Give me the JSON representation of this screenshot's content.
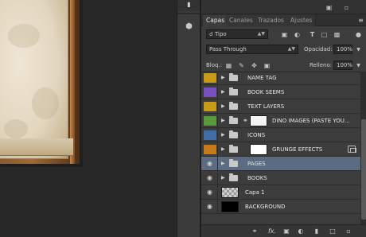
{
  "tabs": [
    {
      "label": "Capas",
      "active": true
    },
    {
      "label": "Canales",
      "active": false
    },
    {
      "label": "Trazados",
      "active": false
    },
    {
      "label": "Ajustes",
      "active": false
    }
  ],
  "filter": {
    "label": "Tipo"
  },
  "blend": {
    "mode": "Pass Through",
    "opacity_label": "Opacidad:",
    "opacity": "100%"
  },
  "lock": {
    "label": "Bloq.:",
    "fill_label": "Relleno:",
    "fill": "100%"
  },
  "layers": [
    {
      "name": "NAME TAG",
      "type": "group",
      "visible": false,
      "tag_color": "#c79a1a",
      "selected": false
    },
    {
      "name": "BOOK SEEMS",
      "type": "group",
      "visible": false,
      "tag_color": "#7a4fc0",
      "selected": false
    },
    {
      "name": "TEXT LAYERS",
      "type": "group",
      "visible": false,
      "tag_color": "#c79a1a",
      "selected": false
    },
    {
      "name": "DINO IMAGES (PASTE YOU...",
      "type": "smart",
      "visible": false,
      "tag_color": "#5a9a3a",
      "selected": false
    },
    {
      "name": "ICONS",
      "type": "group",
      "visible": false,
      "tag_color": "#3f6fa8",
      "selected": false
    },
    {
      "name": "GRUNGE EFFECTS",
      "type": "masked-group",
      "visible": false,
      "tag_color": "#c77a1a",
      "selected": false
    },
    {
      "name": "PAGES",
      "type": "group",
      "visible": true,
      "tag_color": "",
      "selected": true
    },
    {
      "name": "BOOKS",
      "type": "group",
      "visible": true,
      "tag_color": "",
      "selected": false
    },
    {
      "name": "Capa 1",
      "type": "pixel",
      "visible": true,
      "tag_color": "",
      "selected": false
    },
    {
      "name": "BACKGROUND",
      "type": "black-fill",
      "visible": true,
      "tag_color": "",
      "selected": false
    }
  ],
  "icons": {
    "filter": [
      "image-filter-icon",
      "adjustment-filter-icon",
      "type-filter-icon",
      "shape-filter-icon",
      "smart-filter-icon",
      "filter-toggle-icon"
    ],
    "lock": [
      "lock-transparent-icon",
      "lock-paint-icon",
      "lock-position-icon",
      "lock-all-icon"
    ],
    "footer": [
      "link-icon",
      "fx-icon",
      "mask-icon",
      "adjustment-icon",
      "new-group-icon",
      "new-layer-icon",
      "trash-icon"
    ]
  },
  "footer": {
    "fx_label": "fx."
  }
}
